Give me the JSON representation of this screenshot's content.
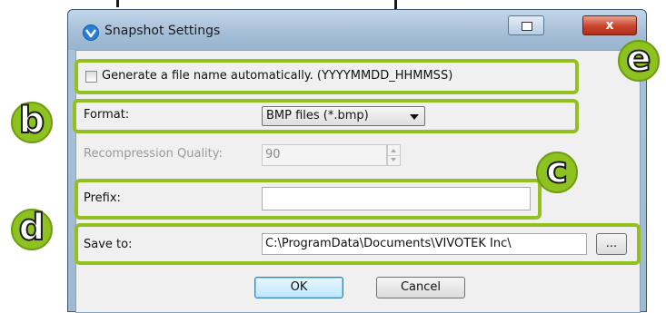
{
  "window": {
    "title": "Snapshot Settings",
    "close_glyph": "x",
    "restore_icon": "restore-icon",
    "app_icon": "vivotek-app-icon"
  },
  "form": {
    "auto_filename_label": "Generate a file name automatically. (YYYYMMDD_HHMMSS)",
    "auto_filename_checked": false,
    "format_label": "Format:",
    "format_value": "BMP files (*.bmp)",
    "quality_label": "Recompression Quality:",
    "quality_value": "90",
    "prefix_label": "Prefix:",
    "prefix_value": "",
    "save_to_label": "Save to:",
    "save_to_value": "C:\\ProgramData\\Documents\\VIVOTEK Inc\\",
    "browse_label": "...",
    "ok_label": "OK",
    "cancel_label": "Cancel"
  },
  "annotations": {
    "b": "b",
    "c": "c",
    "d": "d",
    "e": "e",
    "highlight_color": "#92c01e",
    "badge_color": "#8dc21f"
  }
}
